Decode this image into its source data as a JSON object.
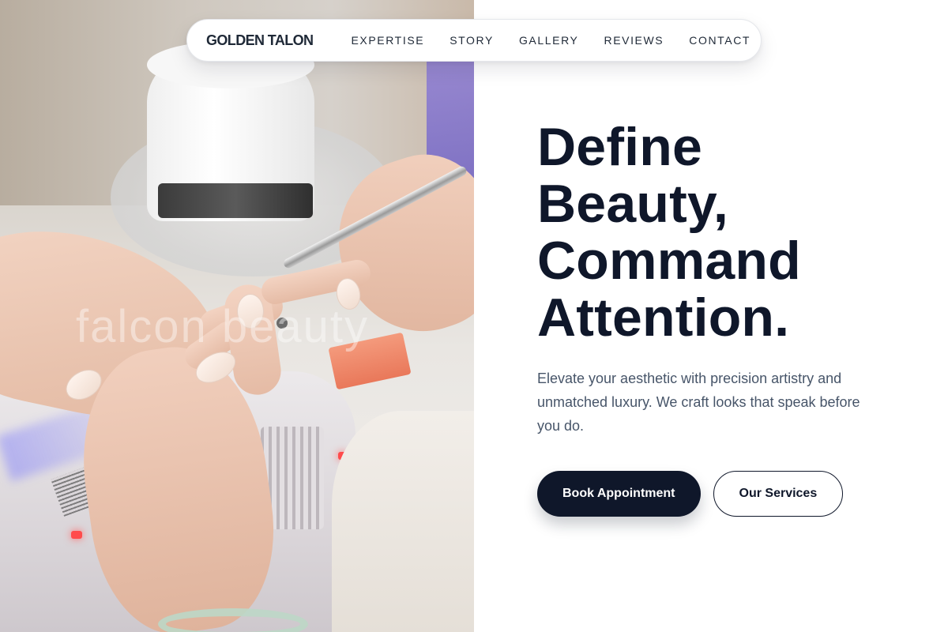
{
  "brand": {
    "name": "GOLDEN TALON"
  },
  "nav": {
    "links": [
      "EXPERTISE",
      "STORY",
      "GALLERY",
      "REVIEWS",
      "CONTACT"
    ]
  },
  "hero": {
    "headline_lines": [
      "Define",
      "Beauty,",
      "Command",
      "Attention."
    ],
    "subtext": "Elevate your aesthetic with precision artistry and unmatched luxury. We craft looks that speak before you do.",
    "primary_cta": "Book Appointment",
    "secondary_cta": "Our Services"
  },
  "image": {
    "description_icon": "manicure-photo",
    "watermark": "falcon beauty"
  },
  "colors": {
    "primary": "#0f172a",
    "text_muted": "#475569",
    "background": "#ffffff"
  }
}
